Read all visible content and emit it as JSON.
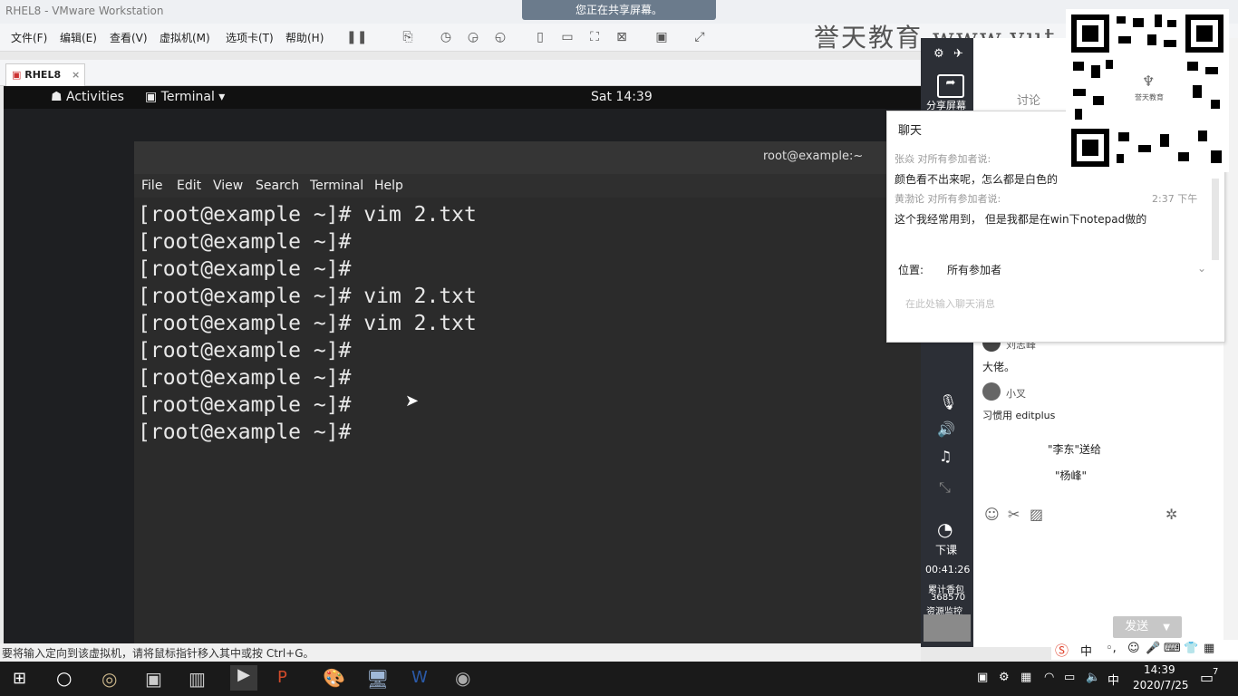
{
  "window": {
    "title": "RHEL8 - VMware Workstation",
    "share_banner": "您正在共享屏幕。"
  },
  "menubar": {
    "items": [
      "文件(F)",
      "编辑(E)",
      "查看(V)",
      "虚拟机(M)",
      "选项卡(T)",
      "帮助(H)"
    ]
  },
  "brand": {
    "text": "誉天教育  www.yut"
  },
  "tabs": [
    {
      "label": "RHEL8",
      "close": "×"
    }
  ],
  "gnome": {
    "activities": "Activities",
    "app": "Terminal ▾",
    "clock": "Sat 14:39"
  },
  "terminal": {
    "title": "root@example:~",
    "menu": [
      "File",
      "Edit",
      "View",
      "Search",
      "Terminal",
      "Help"
    ],
    "lines": [
      "[root@example ~]# vim 2.txt",
      "[root@example ~]#",
      "[root@example ~]#",
      "[root@example ~]# vim 2.txt",
      "[root@example ~]# vim 2.txt",
      "[root@example ~]#",
      "[root@example ~]#",
      "[root@example ~]#",
      "[root@example ~]#"
    ]
  },
  "statusbar": {
    "text": "要将输入定向到该虚拟机，请将鼠标指针移入其中或按 Ctrl+G。"
  },
  "side_strip": {
    "share_label": "分享屏幕",
    "end_label": "下课",
    "timer": "00:41:26",
    "stats": [
      "累计香包",
      "368570",
      "资源监控"
    ]
  },
  "chat_panel": {
    "tab_discussion": "讨论",
    "messages_below": [
      {
        "user": "刘志峰",
        "text": "大佬。"
      },
      {
        "user": "小叉",
        "text": "习惯用 editplus"
      }
    ],
    "gift_line1": "\"李东\"送给",
    "gift_line2": "\"杨峰\"",
    "send": "发送"
  },
  "chat_popup": {
    "header": "聊天",
    "msg1_meta": "张焱 对所有参加者说:",
    "msg1_text": "颜色看不出来呢，怎么都是白色的",
    "msg2_meta": "黄渤论 对所有参加者说:",
    "msg2_time": "2:37 下午",
    "msg2_text": "这个我经常用到，  但是我都是在win下notepad做的",
    "position_label": "位置:",
    "position_value": "所有参加者",
    "input_placeholder": "在此处输入聊天消息"
  },
  "qr": {
    "caption": "誉天教育"
  },
  "ime": {
    "text": "中"
  },
  "taskbar": {
    "time": "14:39",
    "date": "2020/7/25",
    "lang": "中",
    "notif": "7"
  },
  "colors": {
    "accent": "#3c73c8",
    "send_button": "#c7c7c7"
  }
}
